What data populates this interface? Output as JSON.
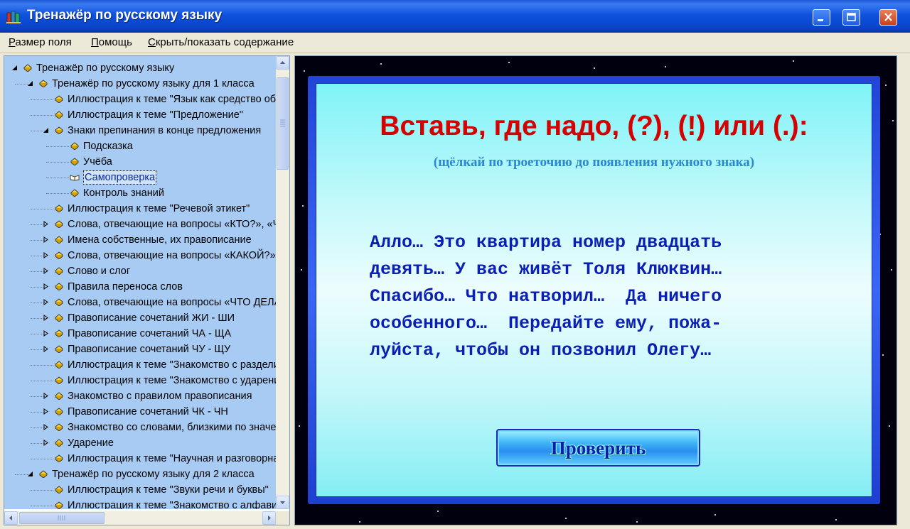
{
  "window": {
    "title": "Тренажёр по русскому языку",
    "icon": "books-icon",
    "buttons": [
      "minimize-icon",
      "maximize-icon",
      "close-icon"
    ]
  },
  "menu": {
    "items": [
      {
        "label": "Размер поля",
        "underline": "Р",
        "rest": "азмер поля"
      },
      {
        "label": "Помощь",
        "underline": "П",
        "rest": "омощь"
      },
      {
        "label": "Скрыть/показать содержание",
        "underline": "С",
        "rest": "крыть/показать содержание"
      }
    ]
  },
  "tree": {
    "items": [
      {
        "label": "Тренажёр по русскому языку",
        "level": 0,
        "expander": "expanded",
        "icon": "closed-book-icon"
      },
      {
        "label": "Тренажёр по русскому языку для 1 класса",
        "level": 1,
        "expander": "expanded",
        "icon": "closed-book-icon"
      },
      {
        "label": "Иллюстрация к теме \"Язык как средство общения\"",
        "level": 2,
        "expander": "none",
        "icon": "closed-book-icon"
      },
      {
        "label": "Иллюстрация к теме \"Предложение\"",
        "level": 2,
        "expander": "none",
        "icon": "closed-book-icon"
      },
      {
        "label": "Знаки препинания в конце предложения",
        "level": 2,
        "expander": "expanded",
        "icon": "closed-book-icon"
      },
      {
        "label": "Подсказка",
        "level": 3,
        "expander": "none",
        "icon": "closed-book-icon"
      },
      {
        "label": "Учёба",
        "level": 3,
        "expander": "none",
        "icon": "closed-book-icon"
      },
      {
        "label": "Самопроверка",
        "level": 3,
        "expander": "none",
        "icon": "open-book-icon",
        "selected": true
      },
      {
        "label": "Контроль знаний",
        "level": 3,
        "expander": "none",
        "icon": "closed-book-icon"
      },
      {
        "label": "Иллюстрация к теме \"Речевой этикет\"",
        "level": 2,
        "expander": "none",
        "icon": "closed-book-icon"
      },
      {
        "label": "Слова, отвечающие на вопросы «КТО?», «ЧТО?»",
        "level": 2,
        "expander": "collapsed",
        "icon": "closed-book-icon"
      },
      {
        "label": "Имена собственные, их правописание",
        "level": 2,
        "expander": "collapsed",
        "icon": "closed-book-icon"
      },
      {
        "label": "Слова, отвечающие на вопросы «КАКОЙ?»",
        "level": 2,
        "expander": "collapsed",
        "icon": "closed-book-icon"
      },
      {
        "label": "Слово и слог",
        "level": 2,
        "expander": "collapsed",
        "icon": "closed-book-icon"
      },
      {
        "label": "Правила переноса слов",
        "level": 2,
        "expander": "collapsed",
        "icon": "closed-book-icon"
      },
      {
        "label": "Слова, отвечающие на вопросы «ЧТО ДЕЛАТЬ?»",
        "level": 2,
        "expander": "collapsed",
        "icon": "closed-book-icon"
      },
      {
        "label": "Правописание сочетаний ЖИ - ШИ",
        "level": 2,
        "expander": "collapsed",
        "icon": "closed-book-icon"
      },
      {
        "label": "Правописание сочетаний ЧА - ЩА",
        "level": 2,
        "expander": "collapsed",
        "icon": "closed-book-icon"
      },
      {
        "label": "Правописание сочетаний ЧУ - ЩУ",
        "level": 2,
        "expander": "collapsed",
        "icon": "closed-book-icon"
      },
      {
        "label": "Иллюстрация к теме \"Знакомство с разделительным мягким знаком\"",
        "level": 2,
        "expander": "none",
        "icon": "closed-book-icon"
      },
      {
        "label": "Иллюстрация к теме \"Знакомство с ударением\"",
        "level": 2,
        "expander": "none",
        "icon": "closed-book-icon"
      },
      {
        "label": "Знакомство с правилом правописания",
        "level": 2,
        "expander": "collapsed",
        "icon": "closed-book-icon"
      },
      {
        "label": "Правописание сочетаний ЧК - ЧН",
        "level": 2,
        "expander": "collapsed",
        "icon": "closed-book-icon"
      },
      {
        "label": "Знакомство со словами, близкими по значению",
        "level": 2,
        "expander": "collapsed",
        "icon": "closed-book-icon"
      },
      {
        "label": "Ударение",
        "level": 2,
        "expander": "collapsed",
        "icon": "closed-book-icon"
      },
      {
        "label": "Иллюстрация к теме \"Научная и разговорная речь\"",
        "level": 2,
        "expander": "none",
        "icon": "closed-book-icon"
      },
      {
        "label": "Тренажёр по русскому языку для 2 класса",
        "level": 1,
        "expander": "expanded",
        "icon": "closed-book-icon"
      },
      {
        "label": "Иллюстрация к теме \"Звуки речи и буквы\"",
        "level": 2,
        "expander": "none",
        "icon": "closed-book-icon"
      },
      {
        "label": "Иллюстрация к теме \"Знакомство с алфавитом\"",
        "level": 2,
        "expander": "none",
        "icon": "closed-book-icon"
      }
    ]
  },
  "exercise": {
    "heading": "Вставь, где надо, (?), (!) или (.):",
    "instruction": "(щёлкай по троеточию до появления нужного знака)",
    "lines": [
      "Алло… Это квартира номер двадцать",
      "девять… У вас живёт Толя Клюквин…",
      "Спасибо… Что натворил…  Да ничего",
      "особенного…  Передайте ему, пожа-",
      "луйста, чтобы он позвонил Олегу…"
    ],
    "check_button": "Проверить"
  },
  "colors": {
    "titlebar": "#0f52de",
    "tree_background": "#a8cbf3",
    "heading": "#d50000",
    "instruction": "#2a86d6",
    "exercise_text": "#0a1fb3"
  }
}
